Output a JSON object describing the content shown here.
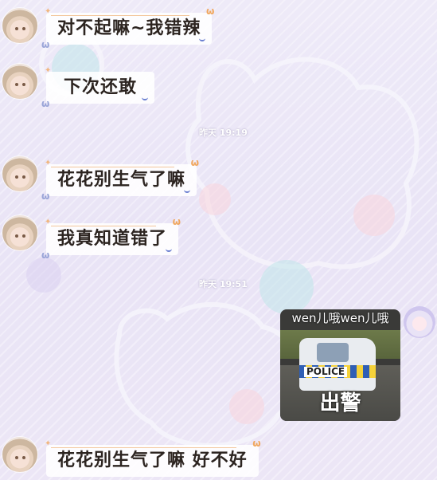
{
  "messages": [
    {
      "text": "对不起嘛~我错辣"
    },
    {
      "text": "下次还敢"
    },
    {
      "text": "花花别生气了嘛"
    },
    {
      "text": "我真知道错了"
    },
    {
      "text": "花花别生气了嘛 好不好"
    }
  ],
  "timestamps": [
    "昨天 19:19",
    "昨天 19:51"
  ],
  "sticker": {
    "sender_name": "wen儿哦wen儿哦",
    "caption": "出警",
    "plate": "POLICE"
  },
  "icons": {
    "avatar_other": "avatar-girl-icon",
    "avatar_self": "avatar-chibi-icon",
    "bubble_decor": "bunny-icon"
  },
  "colors": {
    "background": "#ece6f6",
    "bubble_bg": "#ffffff",
    "bubble_accent": "#f3c79c",
    "text": "#2c2420"
  }
}
